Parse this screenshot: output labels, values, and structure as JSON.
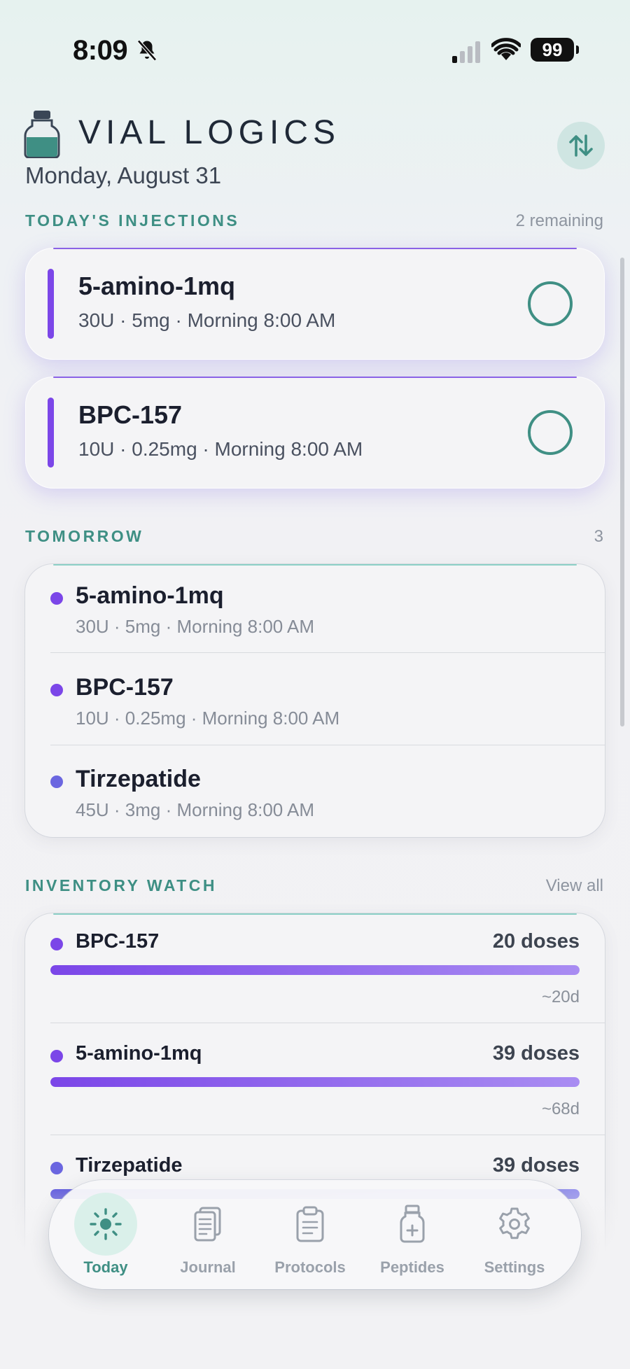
{
  "status_bar": {
    "time": "8:09",
    "battery": "99"
  },
  "header": {
    "app_title": "VIAL LOGICS",
    "date": "Monday, August 31"
  },
  "colors": {
    "accent_teal": "#3f8f84",
    "accent_purple": "#7b46e8",
    "accent_indigo": "#6b66e0"
  },
  "today": {
    "label": "TODAY'S INJECTIONS",
    "remaining": "2 remaining",
    "items": [
      {
        "name": "5-amino-1mq",
        "detail": "30U · 5mg · Morning 8:00 AM",
        "completed": false
      },
      {
        "name": "BPC-157",
        "detail": "10U · 0.25mg · Morning 8:00 AM",
        "completed": false
      }
    ]
  },
  "tomorrow": {
    "label": "TOMORROW",
    "count": "3",
    "items": [
      {
        "name": "5-amino-1mq",
        "detail": "30U · 5mg · Morning 8:00 AM",
        "color": "#7b46e8"
      },
      {
        "name": "BPC-157",
        "detail": "10U · 0.25mg · Morning 8:00 AM",
        "color": "#7b46e8"
      },
      {
        "name": "Tirzepatide",
        "detail": "45U · 3mg · Morning 8:00 AM",
        "color": "#6b66e0"
      }
    ]
  },
  "inventory": {
    "label": "INVENTORY WATCH",
    "view_all": "View all",
    "items": [
      {
        "name": "BPC-157",
        "doses": "20 doses",
        "days": "~20d",
        "level_percent": 100,
        "color": "#7b46e8"
      },
      {
        "name": "5-amino-1mq",
        "doses": "39 doses",
        "days": "~68d",
        "level_percent": 100,
        "color": "#7b46e8"
      },
      {
        "name": "Tirzepatide",
        "doses": "39 doses",
        "days": "",
        "level_percent": 100,
        "color": "#6b66e0"
      }
    ]
  },
  "tabs": [
    {
      "label": "Today",
      "icon": "sun-icon",
      "active": true
    },
    {
      "label": "Journal",
      "icon": "journal-icon",
      "active": false
    },
    {
      "label": "Protocols",
      "icon": "clipboard-icon",
      "active": false
    },
    {
      "label": "Peptides",
      "icon": "vial-icon",
      "active": false
    },
    {
      "label": "Settings",
      "icon": "gear-icon",
      "active": false
    }
  ]
}
